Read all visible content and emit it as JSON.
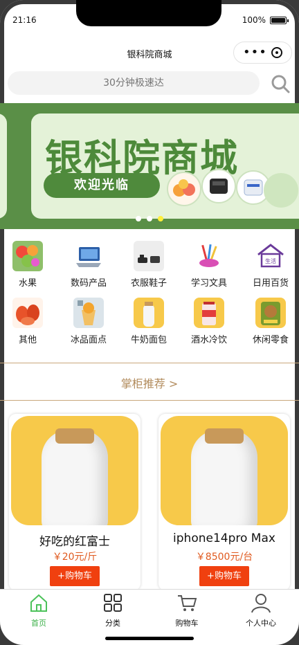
{
  "status": {
    "time": "21:16",
    "battery": "100%"
  },
  "navbar": {
    "title": "银科院商城"
  },
  "search": {
    "placeholder": "30分钟极速达"
  },
  "banner": {
    "headline": "银科院商城",
    "button": "欢迎光临",
    "page_count": 3,
    "active_page": 3
  },
  "categories": [
    {
      "label": "水果",
      "icon": "fruit-icon"
    },
    {
      "label": "数码产品",
      "icon": "laptop-icon"
    },
    {
      "label": "衣服鞋子",
      "icon": "shoes-icon"
    },
    {
      "label": "学习文具",
      "icon": "stationery-icon"
    },
    {
      "label": "日用百货",
      "icon": "house-icon",
      "badge_text": "生活"
    },
    {
      "label": "其他",
      "icon": "crayfish-icon"
    },
    {
      "label": "冰品面点",
      "icon": "dessert-icon"
    },
    {
      "label": "牛奶面包",
      "icon": "milk-icon"
    },
    {
      "label": "酒水冷饮",
      "icon": "drink-icon"
    },
    {
      "label": "休闲零食",
      "icon": "snack-icon"
    }
  ],
  "recommend": {
    "label": "掌柜推荐 >"
  },
  "products": [
    {
      "name": "好吃的红富士",
      "price": "￥20元/斤",
      "button": "+购物车"
    },
    {
      "name": "iphone14pro Max",
      "price": "￥8500元/台",
      "button": "+购物车"
    }
  ],
  "tabbar": [
    {
      "label": "首页",
      "icon": "home-icon",
      "active": true
    },
    {
      "label": "分类",
      "icon": "grid-icon",
      "active": false
    },
    {
      "label": "购物车",
      "icon": "cart-icon",
      "active": false
    },
    {
      "label": "个人中心",
      "icon": "user-icon",
      "active": false
    }
  ],
  "colors": {
    "accent": "#3db14a",
    "banner_bg": "#5a8f47",
    "price": "#e05a1f",
    "button": "#f0400f",
    "recommend": "#b28b5c"
  }
}
